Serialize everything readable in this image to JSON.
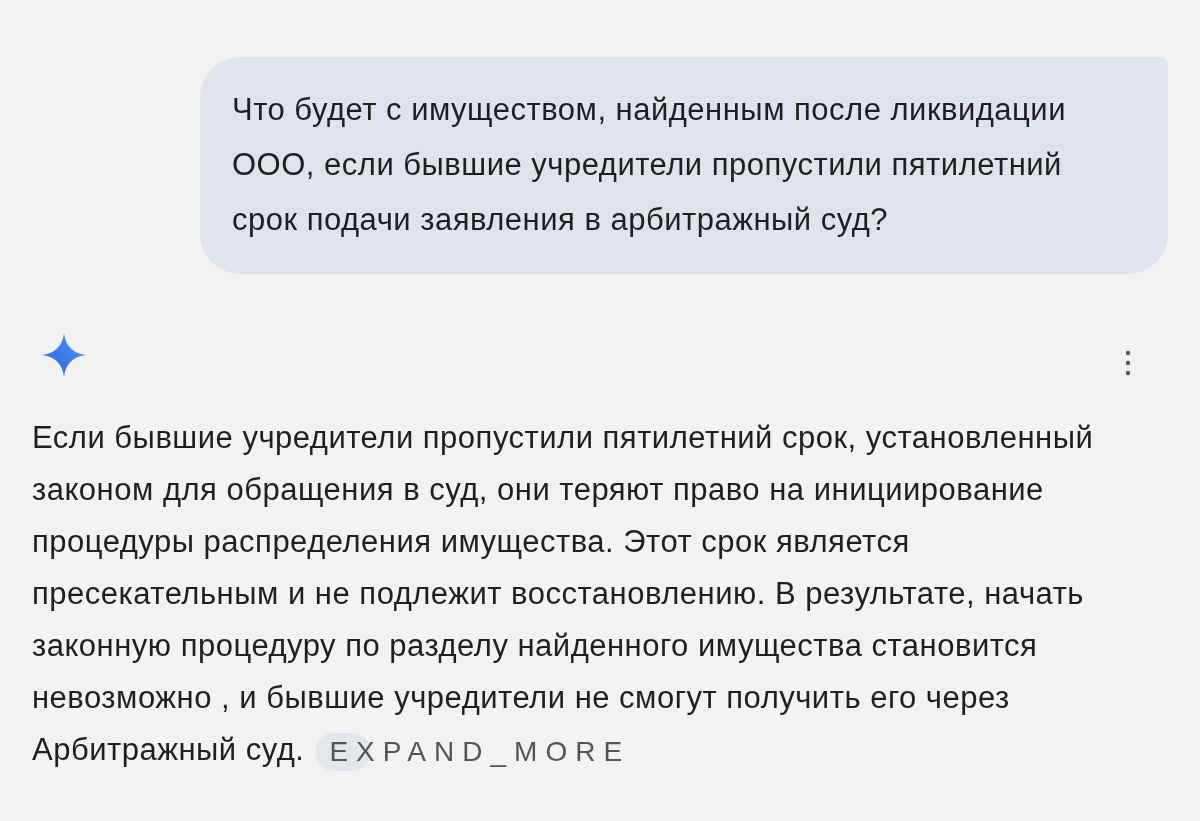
{
  "user_message": {
    "lines": [
      "Что будет с имуществом, найденным после ликвидации",
      "ООО, если бывшие учредители пропустили пятилетний",
      "срок подачи заявления в арбитражный суд?"
    ]
  },
  "response": {
    "lines": [
      "Если бывшие учредители пропустили пятилетний срок, установленный",
      "законом для обращения в суд, они теряют право на инициирование",
      "процедуры распределения имущества. Этот срок является",
      "пресекательным и не подлежит восстановлению. В результате, начать",
      "законную процедуру по разделу найденного имущества становится",
      "невозможно , и бывшие учредители не смогут получить его через",
      "Арбитражный суд."
    ],
    "expand_button": {
      "label": "EXPAND_MORE"
    }
  }
}
